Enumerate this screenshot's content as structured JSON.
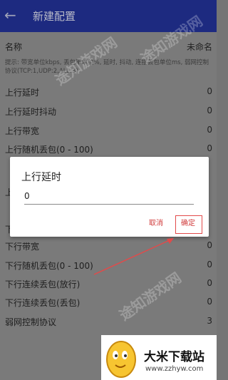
{
  "appbar": {
    "title": "新建配置"
  },
  "form": {
    "name_label": "名称",
    "name_value": "未命名",
    "hint": "提示: 带宽单位kbps, 丢包率单位%, 延时, 抖动, 连接丢包单位ms, 弱网控制协议(TCP:1,UDP:2,ALL:3)",
    "rows": [
      {
        "label": "上行延时",
        "value": "0"
      },
      {
        "label": "上行延时抖动",
        "value": "0"
      },
      {
        "label": "上行带宽",
        "value": "0"
      },
      {
        "label": "上行随机丢包(0 - 100)",
        "value": "0"
      },
      {
        "label": "下行带宽",
        "value": "0"
      },
      {
        "label": "下行随机丢包(0 - 100)",
        "value": "0"
      },
      {
        "label": "下行连续丢包(放行)",
        "value": "0"
      },
      {
        "label": "下行连续丢包(丢包)",
        "value": "0"
      },
      {
        "label": "弱网控制协议",
        "value": "3"
      }
    ]
  },
  "dialog": {
    "title": "上行延时",
    "input_value": "0",
    "cancel_label": "取消",
    "ok_label": "确定"
  },
  "promo": {
    "name": "大米下载站",
    "url": "www.zzhyw.com"
  },
  "watermark": "途知游戏网",
  "colors": {
    "appbar": "#1d2a80",
    "accent": "#d03a3a",
    "annotation": "#e24a4a"
  },
  "icons": {
    "back": "arrow-left",
    "mascot": "egg-mascot"
  }
}
